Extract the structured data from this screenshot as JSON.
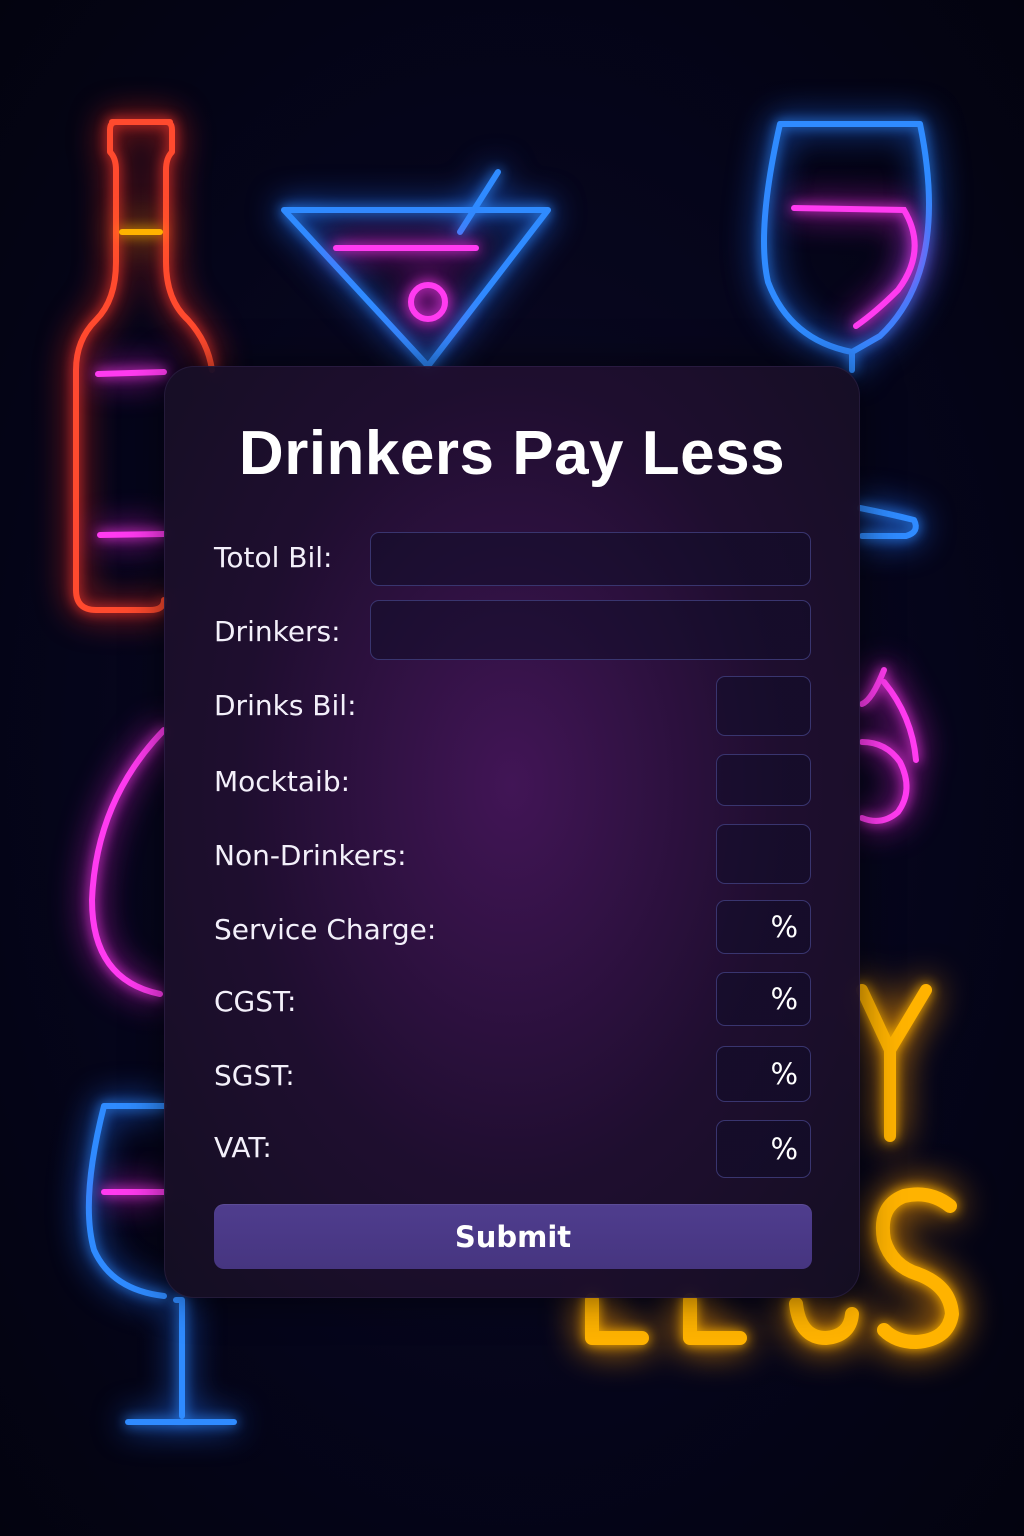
{
  "form": {
    "title": "Drinkers Pay Less",
    "fields": [
      {
        "label": "Totol Bil:",
        "value": "",
        "suffix": ""
      },
      {
        "label": "Drinkers:",
        "value": "",
        "suffix": ""
      },
      {
        "label": "Drinks Bil:",
        "value": "",
        "suffix": ""
      },
      {
        "label": "Mocktaib:",
        "value": "",
        "suffix": ""
      },
      {
        "label": "Non-Drinkers:",
        "value": "",
        "suffix": ""
      },
      {
        "label": "Service Charge:",
        "value": "",
        "suffix": "%"
      },
      {
        "label": "CGST:",
        "value": "",
        "suffix": "%"
      },
      {
        "label": "SGST:",
        "value": "",
        "suffix": "%"
      },
      {
        "label": "VAT:",
        "value": "",
        "suffix": "%"
      }
    ],
    "submit_label": "Submit"
  },
  "background": {
    "neon_icons": [
      "beer-bottle-icon",
      "martini-glass-icon",
      "wine-glass-icon",
      "pear-shape-icon",
      "droplet-icon",
      "wine-glass-icon"
    ],
    "neon_text": "LESS",
    "neon_partial_letter": "Y",
    "colors": {
      "neon_red": "#ff3b2f",
      "neon_blue": "#2f8bff",
      "neon_pink": "#ff3bf0",
      "neon_yellow": "#ffb300",
      "button": "#4f3d8e",
      "field_border": "#39356f"
    }
  }
}
